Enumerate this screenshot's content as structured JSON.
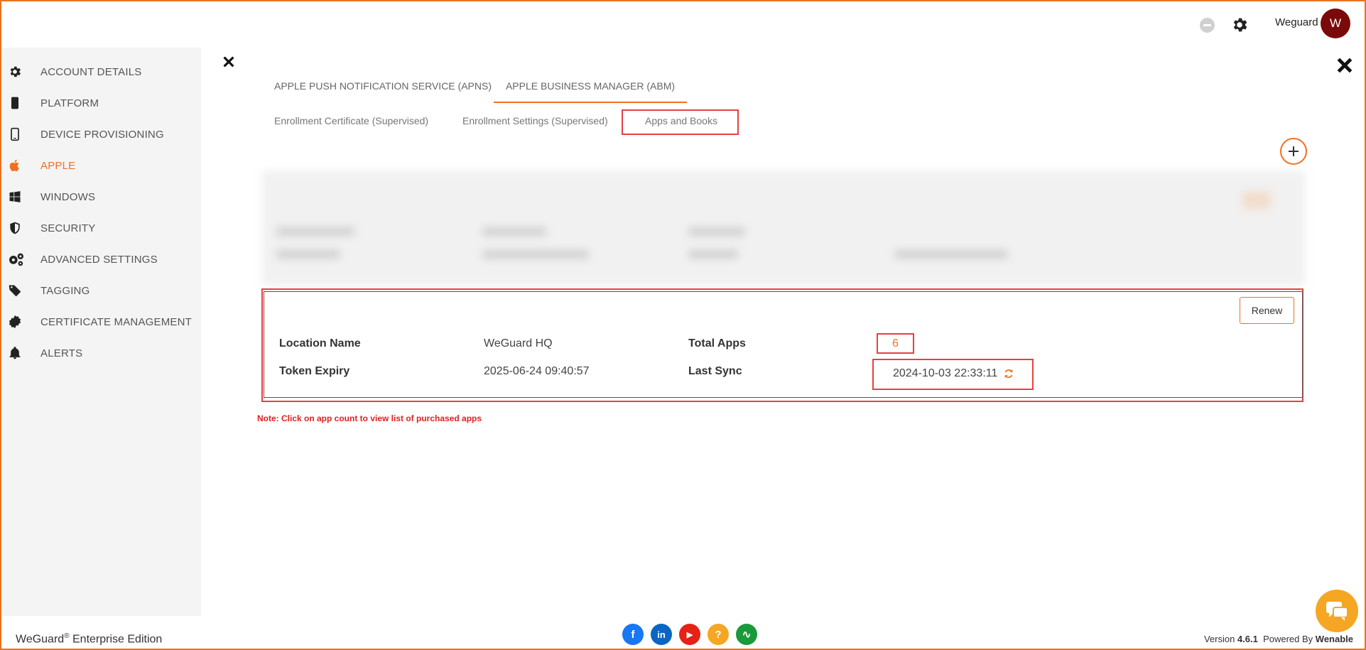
{
  "header": {
    "user_name": "Weguard",
    "avatar_letter": "W"
  },
  "sidebar": {
    "items": [
      {
        "label": "ACCOUNT DETAILS",
        "icon": "gear-icon"
      },
      {
        "label": "PLATFORM",
        "icon": "phone-icon"
      },
      {
        "label": "DEVICE PROVISIONING",
        "icon": "mobile-icon"
      },
      {
        "label": "APPLE",
        "icon": "apple-icon"
      },
      {
        "label": "WINDOWS",
        "icon": "windows-icon"
      },
      {
        "label": "SECURITY",
        "icon": "shield-icon"
      },
      {
        "label": "ADVANCED SETTINGS",
        "icon": "gears-icon"
      },
      {
        "label": "TAGGING",
        "icon": "tag-icon"
      },
      {
        "label": "CERTIFICATE MANAGEMENT",
        "icon": "certificate-icon"
      },
      {
        "label": "ALERTS",
        "icon": "bell-icon"
      }
    ],
    "active_index": 3
  },
  "tabs": {
    "main": [
      "APPLE PUSH NOTIFICATION SERVICE (APNS)",
      "APPLE BUSINESS MANAGER (ABM)"
    ],
    "sub": [
      "Enrollment Certificate (Supervised)",
      "Enrollment Settings (Supervised)",
      "Apps and Books"
    ]
  },
  "card": {
    "renew_label": "Renew",
    "location_name_label": "Location Name",
    "location_name_value": "WeGuard HQ",
    "token_expiry_label": "Token Expiry",
    "token_expiry_value": "2025-06-24 09:40:57",
    "total_apps_label": "Total Apps",
    "total_apps_value": "6",
    "last_sync_label": "Last Sync",
    "last_sync_value": "2024-10-03 22:33:11"
  },
  "note": "Note: Click on app count to view list of purchased apps",
  "footer": {
    "brand": "WeGuard",
    "registered": "®",
    "edition": " Enterprise Edition",
    "version_prefix": "Version ",
    "version": "4.6.1",
    "powered_prefix": "  Powered By ",
    "powered_by": "Wenable",
    "social": [
      {
        "name": "facebook-icon",
        "glyph": "f",
        "color": "#1877f2"
      },
      {
        "name": "linkedin-icon",
        "glyph": "in",
        "color": "#0a66c2"
      },
      {
        "name": "youtube-icon",
        "glyph": "▶",
        "color": "#e62117"
      },
      {
        "name": "help-icon",
        "glyph": "?",
        "color": "#f5a623"
      },
      {
        "name": "activity-icon",
        "glyph": "∿",
        "color": "#1a9a3a"
      }
    ]
  },
  "colors": {
    "accent": "#f07020",
    "highlight": "#e84040",
    "note": "#e02020"
  }
}
